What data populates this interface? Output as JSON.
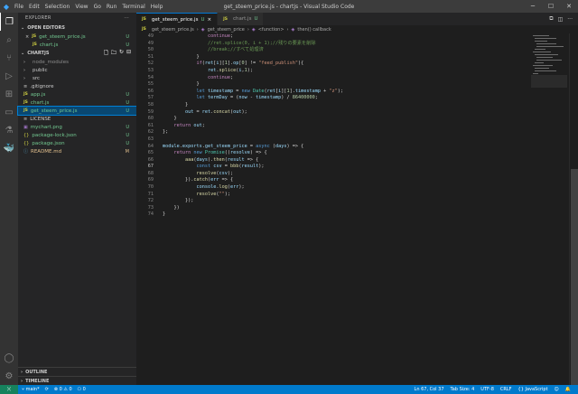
{
  "window": {
    "title": "get_steem_price.js - chartjs - Visual Studio Code",
    "menu": [
      "File",
      "Edit",
      "Selection",
      "View",
      "Go",
      "Run",
      "Terminal",
      "Help"
    ]
  },
  "sidebar": {
    "header": "EXPLORER",
    "open_editors_title": "OPEN EDITORS",
    "open_editors": [
      {
        "name": "get_steem_price.js",
        "badge": "U",
        "close": "×"
      },
      {
        "name": "chart.js",
        "badge": "U"
      }
    ],
    "project_title": "CHARTJS",
    "files": [
      {
        "name": "node_modules",
        "type": "folder",
        "badge": ""
      },
      {
        "name": "public",
        "type": "folder",
        "badge": ""
      },
      {
        "name": "src",
        "type": "folder",
        "badge": ""
      },
      {
        "name": ".gitignore",
        "type": "file",
        "badge": ""
      },
      {
        "name": "app.js",
        "type": "js",
        "badge": "U"
      },
      {
        "name": "chart.js",
        "type": "js",
        "badge": "U"
      },
      {
        "name": "get_steem_price.js",
        "type": "js",
        "badge": "U",
        "selected": true
      },
      {
        "name": "LICENSE",
        "type": "file",
        "badge": ""
      },
      {
        "name": "mychart.png",
        "type": "img",
        "badge": "U"
      },
      {
        "name": "package-lock.json",
        "type": "json",
        "badge": "U"
      },
      {
        "name": "package.json",
        "type": "json",
        "badge": "U"
      },
      {
        "name": "README.md",
        "type": "md",
        "badge": "M"
      }
    ],
    "outline": "OUTLINE",
    "timeline": "TIMELINE"
  },
  "tabs": [
    {
      "name": "get_steem_price.js",
      "badge": "U",
      "active": true
    },
    {
      "name": "chart.js",
      "badge": "U",
      "active": false
    }
  ],
  "breadcrumb": [
    "get_steem_price.js",
    "get_steem_price",
    "<function>",
    "then() callback"
  ],
  "code_lines": [
    {
      "n": "49",
      "text": "                continue;"
    },
    {
      "n": "49",
      "text": "                //ret.splice(0, i + 1);//残りの要素を削除"
    },
    {
      "n": "50",
      "text": "                //break;//すべて処理済"
    },
    {
      "n": "51",
      "text": "            }"
    },
    {
      "n": "52",
      "text": "            if(ret[i][1].op[0] != \"feed_publish\"){"
    },
    {
      "n": "53",
      "text": "                ret.splice(i,1);"
    },
    {
      "n": "54",
      "text": "                continue;"
    },
    {
      "n": "55",
      "text": "            }"
    },
    {
      "n": "56",
      "text": "            let timestamp = new Date(ret[i][1].timestamp + \"z\");"
    },
    {
      "n": "57",
      "text": "            let termDay = (now - timestamp) / 86400000;"
    },
    {
      "n": "58",
      "text": "        }"
    },
    {
      "n": "59",
      "text": "        out = ret.concat(out);"
    },
    {
      "n": "60",
      "text": "    }"
    },
    {
      "n": "61",
      "text": "    return out;"
    },
    {
      "n": "62",
      "text": "};"
    },
    {
      "n": "63",
      "text": ""
    },
    {
      "n": "64",
      "text": "module.exports.get_steem_price = async (days) => {"
    },
    {
      "n": "65",
      "text": "    return new Promise((resolve) => {"
    },
    {
      "n": "66",
      "text": "        aaa(days).then(result => {"
    },
    {
      "n": "67",
      "text": "            const csv = bbb(result);"
    },
    {
      "n": "68",
      "text": "            resolve(csv);"
    },
    {
      "n": "69",
      "text": "        }).catch(err => {"
    },
    {
      "n": "70",
      "text": "            console.log(err);"
    },
    {
      "n": "71",
      "text": "            resolve(\"\");"
    },
    {
      "n": "72",
      "text": "        });"
    },
    {
      "n": "73",
      "text": "    })"
    },
    {
      "n": "74",
      "text": "}"
    }
  ],
  "status": {
    "branch": "main*",
    "sync": "⟳",
    "errors": "0",
    "warnings": "0",
    "ports": "0",
    "position": "Ln 67, Col 37",
    "tab_size": "Tab Size: 4",
    "encoding": "UTF-8",
    "eol": "CRLF",
    "language": "JavaScript"
  }
}
